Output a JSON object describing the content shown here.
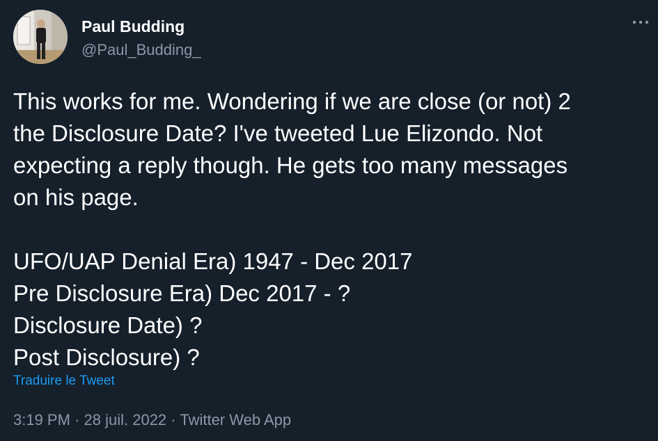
{
  "author": {
    "display_name": "Paul Budding",
    "handle": "@Paul_Budding_"
  },
  "more_menu_icon": "more-horizontal-icon",
  "tweet": {
    "paragraph1": [
      "This works for me. Wondering if we are close (or not) 2",
      "the Disclosure Date? I've tweeted Lue Elizondo. Not",
      "expecting a reply though. He gets too many messages",
      "on his page."
    ],
    "paragraph2": [
      "UFO/UAP Denial Era) 1947 - Dec 2017",
      "Pre Disclosure Era) Dec 2017 - ?",
      "Disclosure Date) ?",
      "Post Disclosure) ?"
    ]
  },
  "translate_label": "Traduire le Tweet",
  "meta": {
    "time": "3:19 PM",
    "separator": "·",
    "date": "28 juil. 2022",
    "source": "Twitter Web App"
  },
  "colors": {
    "background": "#15202b",
    "text": "#ffffff",
    "secondary": "#8b98a5",
    "link": "#1d9bf0"
  }
}
